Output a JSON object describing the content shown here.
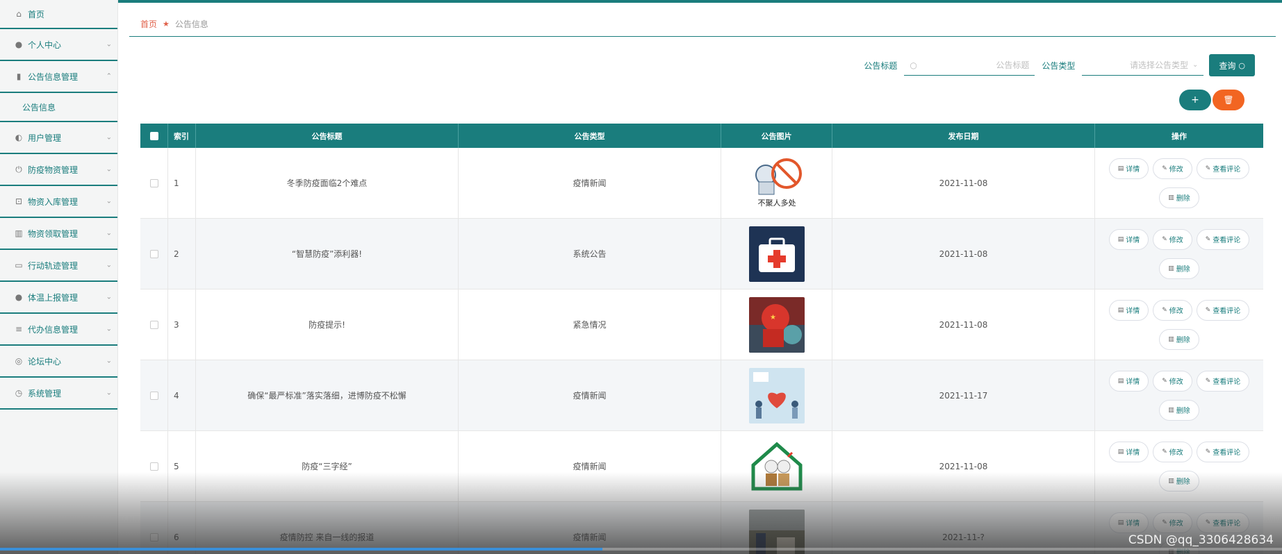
{
  "sidebar": {
    "items": [
      {
        "label": "首页",
        "icon": "home-icon",
        "glyph": "⌂",
        "chevron": false
      },
      {
        "label": "个人中心",
        "icon": "user-icon",
        "glyph": "●",
        "chevron": true
      },
      {
        "label": "公告信息管理",
        "icon": "chart-icon",
        "glyph": "▮",
        "chevron": true,
        "expanded": true
      },
      {
        "label": "用户管理",
        "icon": "mic-icon",
        "glyph": "◐",
        "chevron": true
      },
      {
        "label": "防疫物资管理",
        "icon": "power-icon",
        "glyph": "⏻",
        "chevron": true
      },
      {
        "label": "物资入库管理",
        "icon": "crop-icon",
        "glyph": "⊡",
        "chevron": true
      },
      {
        "label": "物资领取管理",
        "icon": "bar-chart-icon",
        "glyph": "▥",
        "chevron": true
      },
      {
        "label": "行动轨迹管理",
        "icon": "id-card-icon",
        "glyph": "▭",
        "chevron": true
      },
      {
        "label": "体温上报管理",
        "icon": "person-icon",
        "glyph": "●",
        "chevron": true
      },
      {
        "label": "代办信息管理",
        "icon": "menu-icon",
        "glyph": "≡",
        "chevron": true
      },
      {
        "label": "论坛中心",
        "icon": "compass-icon",
        "glyph": "◎",
        "chevron": true
      },
      {
        "label": "系统管理",
        "icon": "clock-icon",
        "glyph": "◷",
        "chevron": true
      }
    ],
    "sub_item": "公告信息"
  },
  "breadcrumb": {
    "home": "首页",
    "current": "公告信息"
  },
  "search": {
    "title_label": "公告标题",
    "title_placeholder": "公告标题",
    "type_label": "公告类型",
    "type_placeholder": "请选择公告类型",
    "query_button": "查询"
  },
  "buttons": {
    "add": "+",
    "delete": "🗑"
  },
  "table": {
    "headers": {
      "index": "索引",
      "title": "公告标题",
      "type": "公告类型",
      "image": "公告图片",
      "date": "发布日期",
      "ops": "操作"
    },
    "op_labels": {
      "detail": "详情",
      "edit": "修改",
      "comments": "查看评论",
      "delete": "删除"
    },
    "rows": [
      {
        "index": "1",
        "title": "冬季防疫面临2个难点",
        "type": "疫情新闻",
        "date": "2021-11-08",
        "image": "no-gathering-image"
      },
      {
        "index": "2",
        "title": "“智慧防疫”添利器!",
        "type": "系统公告",
        "date": "2021-11-08",
        "image": "first-aid-kit-image"
      },
      {
        "index": "3",
        "title": "防疫提示!",
        "type": "紧急情况",
        "date": "2021-11-08",
        "image": "fist-virus-image"
      },
      {
        "index": "4",
        "title": "确保“最严标准”落实落细，进博防疫不松懈",
        "type": "疫情新闻",
        "date": "2021-11-17",
        "image": "heart-people-image"
      },
      {
        "index": "5",
        "title": "防疫“三字经”",
        "type": "疫情新闻",
        "date": "2021-11-08",
        "image": "house-elders-image"
      },
      {
        "index": "6",
        "title": "疫情防控 来自一线的报道",
        "type": "疫情新闻",
        "date": "2021-11-?",
        "image": "frontline-photo-image"
      }
    ]
  },
  "overlay": {
    "watermark": "CSDN @qq_3306428634"
  },
  "colors": {
    "accent": "#1a7d7d",
    "danger": "#f26522",
    "breadcrumb_home": "#e0614a"
  }
}
